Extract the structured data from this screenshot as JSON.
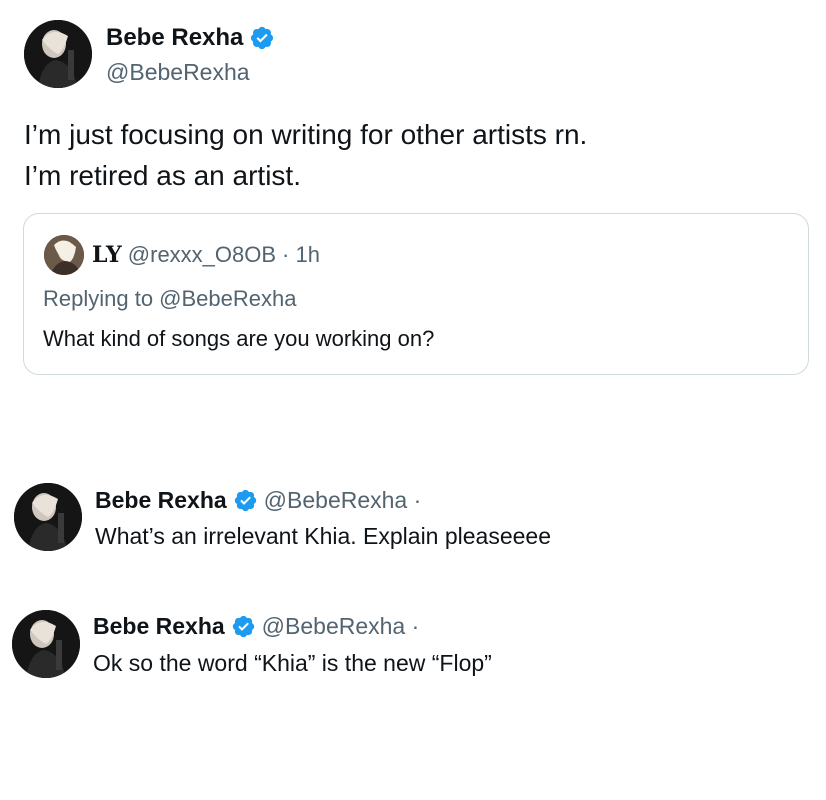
{
  "main_tweet": {
    "author_name": "Bebe Rexha",
    "author_handle": "@BebeRexha",
    "verified_icon": "verified-badge-icon",
    "text_line1": "I’m just focusing on writing for other artists rn.",
    "text_line2": "I’m retired as an artist."
  },
  "quoted_tweet": {
    "author_name": "LY",
    "author_handle": "@rexxx_O8OB",
    "time_text": "· 1h",
    "replying_to": "Replying to @BebeRexha",
    "text": "What kind of songs are you working on?"
  },
  "replies": [
    {
      "author_name": "Bebe Rexha",
      "author_handle": "@BebeRexha ·",
      "text": "What’s an irrelevant Khia. Explain pleaseeee"
    },
    {
      "author_name": "Bebe Rexha",
      "author_handle": "@BebeRexha ·",
      "text": "Ok so the word “Khia” is the new “Flop”"
    }
  ],
  "colors": {
    "verified_blue": "#1d9bf0",
    "secondary_text": "#536471",
    "primary_text": "#0f1419",
    "card_border": "#cfd9de"
  }
}
